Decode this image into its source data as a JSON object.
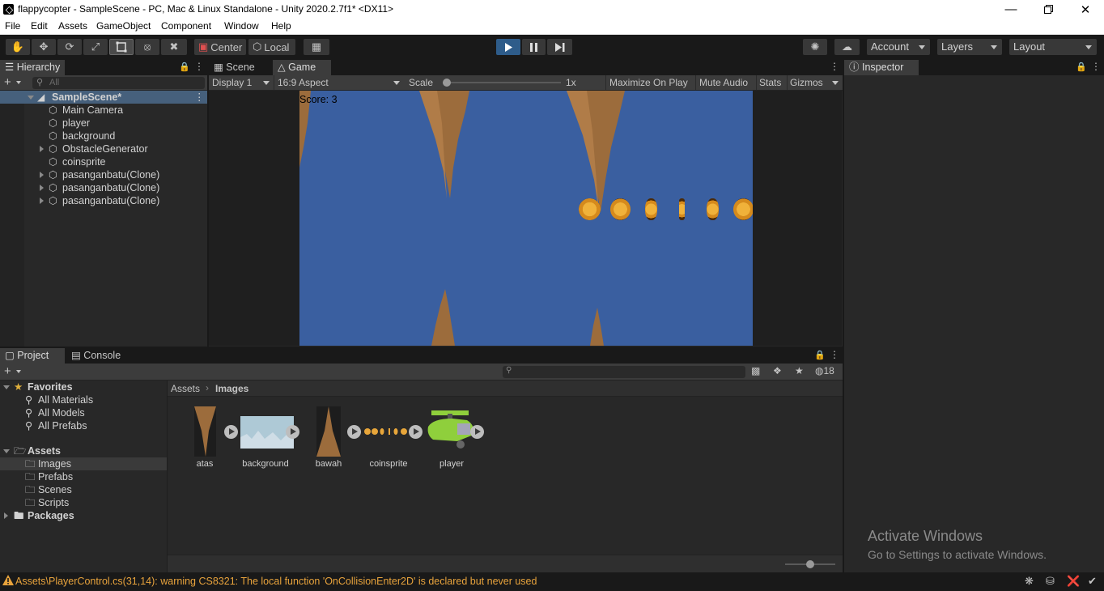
{
  "window": {
    "title": "flappycopter - SampleScene - PC, Mac & Linux Standalone - Unity 2020.2.7f1* <DX11>"
  },
  "menu": [
    "File",
    "Edit",
    "Assets",
    "GameObject",
    "Component",
    "Window",
    "Help"
  ],
  "toolbar": {
    "pivot_label": "Center",
    "space_label": "Local",
    "account_label": "Account",
    "layers_label": "Layers",
    "layout_label": "Layout",
    "play_state": "playing",
    "accent_color": "#2e5c8a"
  },
  "hierarchy": {
    "tab_label": "Hierarchy",
    "search_placeholder": "All",
    "scene_name": "SampleScene*",
    "items": [
      {
        "label": "Main Camera",
        "has_children": false
      },
      {
        "label": "player",
        "has_children": false
      },
      {
        "label": "background",
        "has_children": false
      },
      {
        "label": "ObstacleGenerator",
        "has_children": true
      },
      {
        "label": "coinsprite",
        "has_children": false
      },
      {
        "label": "pasanganbatu(Clone)",
        "has_children": true
      },
      {
        "label": "pasanganbatu(Clone)",
        "has_children": true
      },
      {
        "label": "pasanganbatu(Clone)",
        "has_children": true
      }
    ]
  },
  "scene_tabs": {
    "scene_label": "Scene",
    "game_label": "Game"
  },
  "game_bar": {
    "display": "Display 1",
    "aspect": "16:9 Aspect",
    "scale_label": "Scale",
    "scale_value": "1x",
    "scale_level": 0,
    "maximize": "Maximize On Play",
    "mute": "Mute Audio",
    "stats": "Stats",
    "gizmos": "Gizmos"
  },
  "game": {
    "score_text": "Score: 3",
    "sky_color": "#3a5fa0",
    "rock_color": "#9c6c3c"
  },
  "inspector": {
    "tab_label": "Inspector"
  },
  "project": {
    "tab_label": "Project",
    "console_label": "Console",
    "hidden_count": "18",
    "favorites_label": "Favorites",
    "favorites": [
      "All Materials",
      "All Models",
      "All Prefabs"
    ],
    "assets_label": "Assets",
    "asset_folders": [
      "Images",
      "Prefabs",
      "Scenes",
      "Scripts"
    ],
    "packages_label": "Packages",
    "breadcrumb": [
      "Assets",
      "Images"
    ],
    "assets": [
      "atas",
      "background",
      "bawah",
      "coinsprite",
      "player"
    ]
  },
  "activation": {
    "title": "Activate Windows",
    "subtitle": "Go to Settings to activate Windows."
  },
  "status": {
    "message": "Assets\\PlayerControl.cs(31,14): warning CS8321: The local function 'OnCollisionEnter2D' is declared but never used",
    "warning_color": "#e8a33c"
  }
}
